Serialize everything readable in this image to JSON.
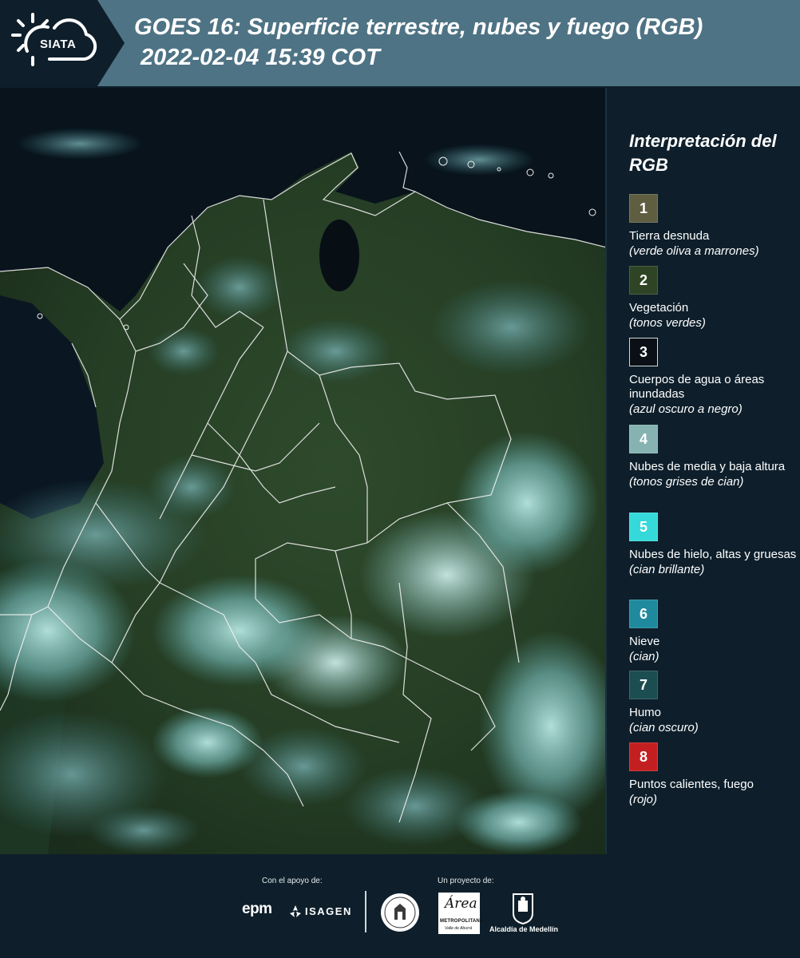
{
  "header": {
    "logo_text": "SIATA",
    "title": "GOES 16: Superficie terrestre, nubes y fuego (RGB)",
    "datetime": "2022-02-04 15:39 COT"
  },
  "legend": {
    "title": "Interpretación del RGB",
    "items": [
      {
        "number": "1",
        "label": "Tierra desnuda",
        "desc": "(verde oliva a marrones)",
        "color": "#5f5e41"
      },
      {
        "number": "2",
        "label": "Vegetación",
        "desc": "(tonos verdes)",
        "color": "#2e4424"
      },
      {
        "number": "3",
        "label": "Cuerpos de agua o áreas inundadas",
        "desc": "(azul oscuro a negro)",
        "color": "#0b1016"
      },
      {
        "number": "4",
        "label": "Nubes de media y baja altura",
        "desc": "(tonos grises de cian)",
        "color": "#86b2b2"
      },
      {
        "number": "5",
        "label": "Nubes de hielo, altas y gruesas",
        "desc": "(cian brillante)",
        "color": "#36d9d9"
      },
      {
        "number": "6",
        "label": "Nieve",
        "desc": "(cian)",
        "color": "#1f8a9e"
      },
      {
        "number": "7",
        "label": "Humo",
        "desc": "(cian oscuro)",
        "color": "#1c4d50"
      },
      {
        "number": "8",
        "label": "Puntos calientes, fuego",
        "desc": "(rojo)",
        "color": "#c41f20"
      }
    ]
  },
  "footer": {
    "support_label": "Con el apoyo de:",
    "project_label": "Un proyecto de:",
    "epm": "epm",
    "isagen": "ISAGEN",
    "area_title": "Área",
    "area_sub": "METROPOLITANA",
    "area_sub2": "Valle de Aburrá",
    "alcaldia": "Alcaldía de Medellín"
  }
}
